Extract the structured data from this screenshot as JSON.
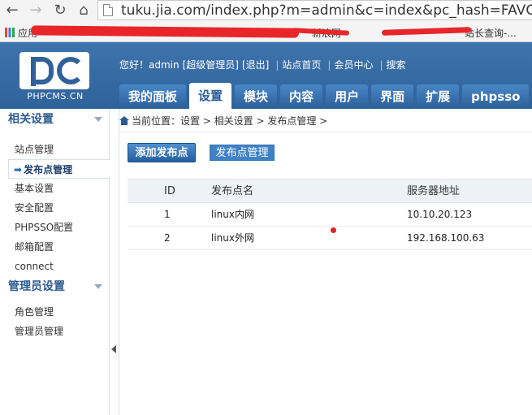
{
  "browser": {
    "url": "tuku.jia.com/index.php?m=admin&c=index&pc_hash=FAVCDW",
    "bookmarks": {
      "apps_label": "应用",
      "visible_fragment_1": "新浪网",
      "visible_fragment_2": "站长查询-..."
    }
  },
  "cms": {
    "logo_text": "PHPCMS.CN",
    "welcome": {
      "greeting": "您好！admin",
      "role": "[超级管理员]",
      "logout": "[退出]",
      "site_home": "站点首页",
      "member_center": "会员中心",
      "search": "搜索"
    },
    "tabs": [
      {
        "label": "我的面板"
      },
      {
        "label": "设置"
      },
      {
        "label": "模块"
      },
      {
        "label": "内容"
      },
      {
        "label": "用户"
      },
      {
        "label": "界面"
      },
      {
        "label": "扩展"
      },
      {
        "label": "phpsso"
      }
    ]
  },
  "sidebar": {
    "group1": {
      "title": "相关设置",
      "items": [
        {
          "label": "站点管理"
        },
        {
          "label": "发布点管理"
        },
        {
          "label": "基本设置"
        },
        {
          "label": "安全配置"
        },
        {
          "label": "PHPSSO配置"
        },
        {
          "label": "邮箱配置"
        },
        {
          "label": "connect"
        }
      ]
    },
    "group2": {
      "title": "管理员设置",
      "items": [
        {
          "label": "角色管理"
        },
        {
          "label": "管理员管理"
        }
      ]
    }
  },
  "breadcrumb": {
    "text": "当前位置：设置 > 相关设置 > 发布点管理 >"
  },
  "actions": {
    "add": "添加发布点",
    "manage": "发布点管理"
  },
  "table": {
    "headers": {
      "id": "ID",
      "name": "发布点名",
      "addr": "服务器地址"
    },
    "rows": [
      {
        "id": "1",
        "name": "linux内网",
        "addr": "10.10.20.123"
      },
      {
        "id": "2",
        "name": "linux外网",
        "addr": "192.168.100.63"
      }
    ]
  },
  "colors": {
    "header_blue": "#2f6299",
    "accent": "#3f82c6",
    "redaction": "#e8262a"
  }
}
